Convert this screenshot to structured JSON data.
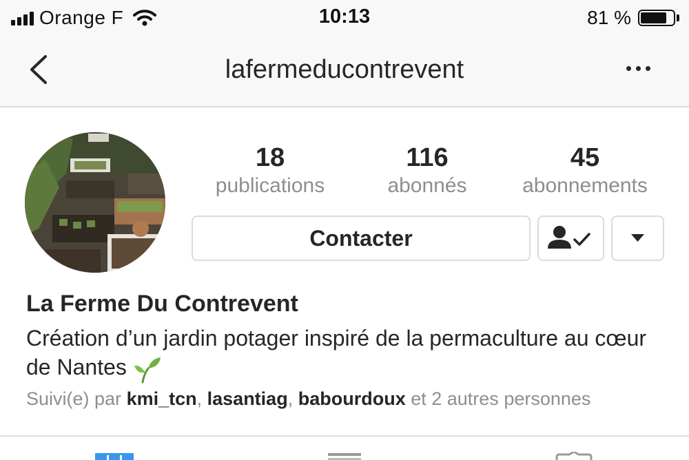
{
  "status_bar": {
    "carrier": "Orange F",
    "time": "10:13",
    "battery_percent": "81 %",
    "battery_level": 0.81
  },
  "header": {
    "title": "lafermeducontrevent"
  },
  "profile": {
    "stats": [
      {
        "value": "18",
        "label": "publications"
      },
      {
        "value": "116",
        "label": "abonnés"
      },
      {
        "value": "45",
        "label": "abonnements"
      }
    ],
    "contact_label": "Contacter",
    "name": "La Ferme Du Contrevent",
    "bio": "Création d’un jardin potager inspiré de la permaculture au cœur de Nantes",
    "followed_by": {
      "prefix": "Suivi(e) par",
      "users": [
        "kmi_tcn",
        "lasantiag",
        "babourdoux"
      ],
      "suffix": "et 2 autres personnes"
    }
  },
  "icons": {
    "back": "chevron-left-icon",
    "more": "more-horizontal-icon",
    "following": "person-check-icon",
    "dropdown": "caret-down-icon",
    "bio_emoji": "seedling-icon",
    "tabs": [
      "grid-icon",
      "list-icon",
      "tagged-icon"
    ]
  },
  "colors": {
    "accent_blue": "#3897f0",
    "text_primary": "#262626",
    "text_secondary": "#8e8e8e",
    "border": "#dbdbdb"
  }
}
